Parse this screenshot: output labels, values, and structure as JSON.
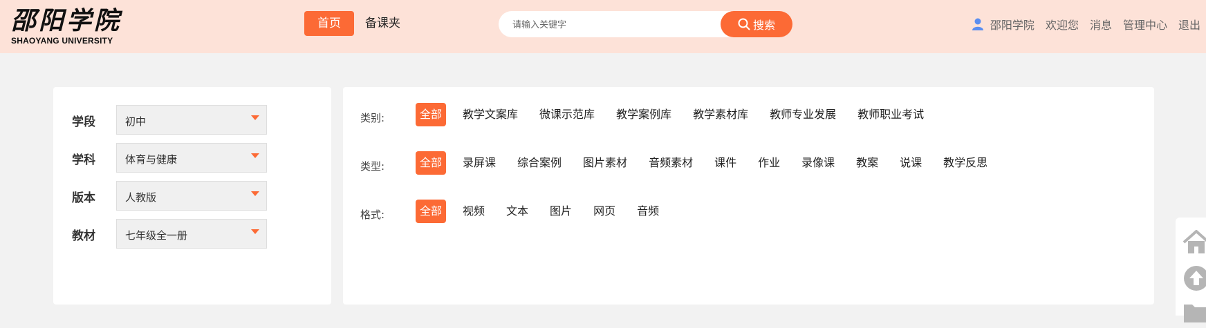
{
  "header": {
    "logo_cn": "邵阳学院",
    "logo_en": "SHAOYANG UNIVERSITY",
    "nav_home": "首页",
    "nav_fav": "备课夹",
    "search_placeholder": "请输入关键字",
    "search_button": "搜索",
    "user_items": [
      "邵阳学院",
      "欢迎您",
      "消息",
      "管理中心",
      "退出"
    ]
  },
  "filters": [
    {
      "label": "学段",
      "value": "初中"
    },
    {
      "label": "学科",
      "value": "体育与健康"
    },
    {
      "label": "版本",
      "value": "人教版"
    },
    {
      "label": "教材",
      "value": "七年级全一册"
    }
  ],
  "categories": [
    {
      "label": "类别:",
      "items": [
        "全部",
        "教学文案库",
        "微课示范库",
        "教学案例库",
        "教学素材库",
        "教师专业发展",
        "教师职业考试"
      ]
    },
    {
      "label": "类型:",
      "items": [
        "全部",
        "录屏课",
        "综合案例",
        "图片素材",
        "音频素材",
        "课件",
        "作业",
        "录像课",
        "教案",
        "说课",
        "教学反思"
      ]
    },
    {
      "label": "格式:",
      "items": [
        "全部",
        "视频",
        "文本",
        "图片",
        "网页",
        "音频"
      ]
    }
  ],
  "colors": {
    "accent": "#fc6a35",
    "header_bg": "#fde2d8",
    "page_bg": "#f2f2f2"
  },
  "side_icons": [
    "home-icon",
    "arrow-up-icon",
    "folder-icon"
  ]
}
